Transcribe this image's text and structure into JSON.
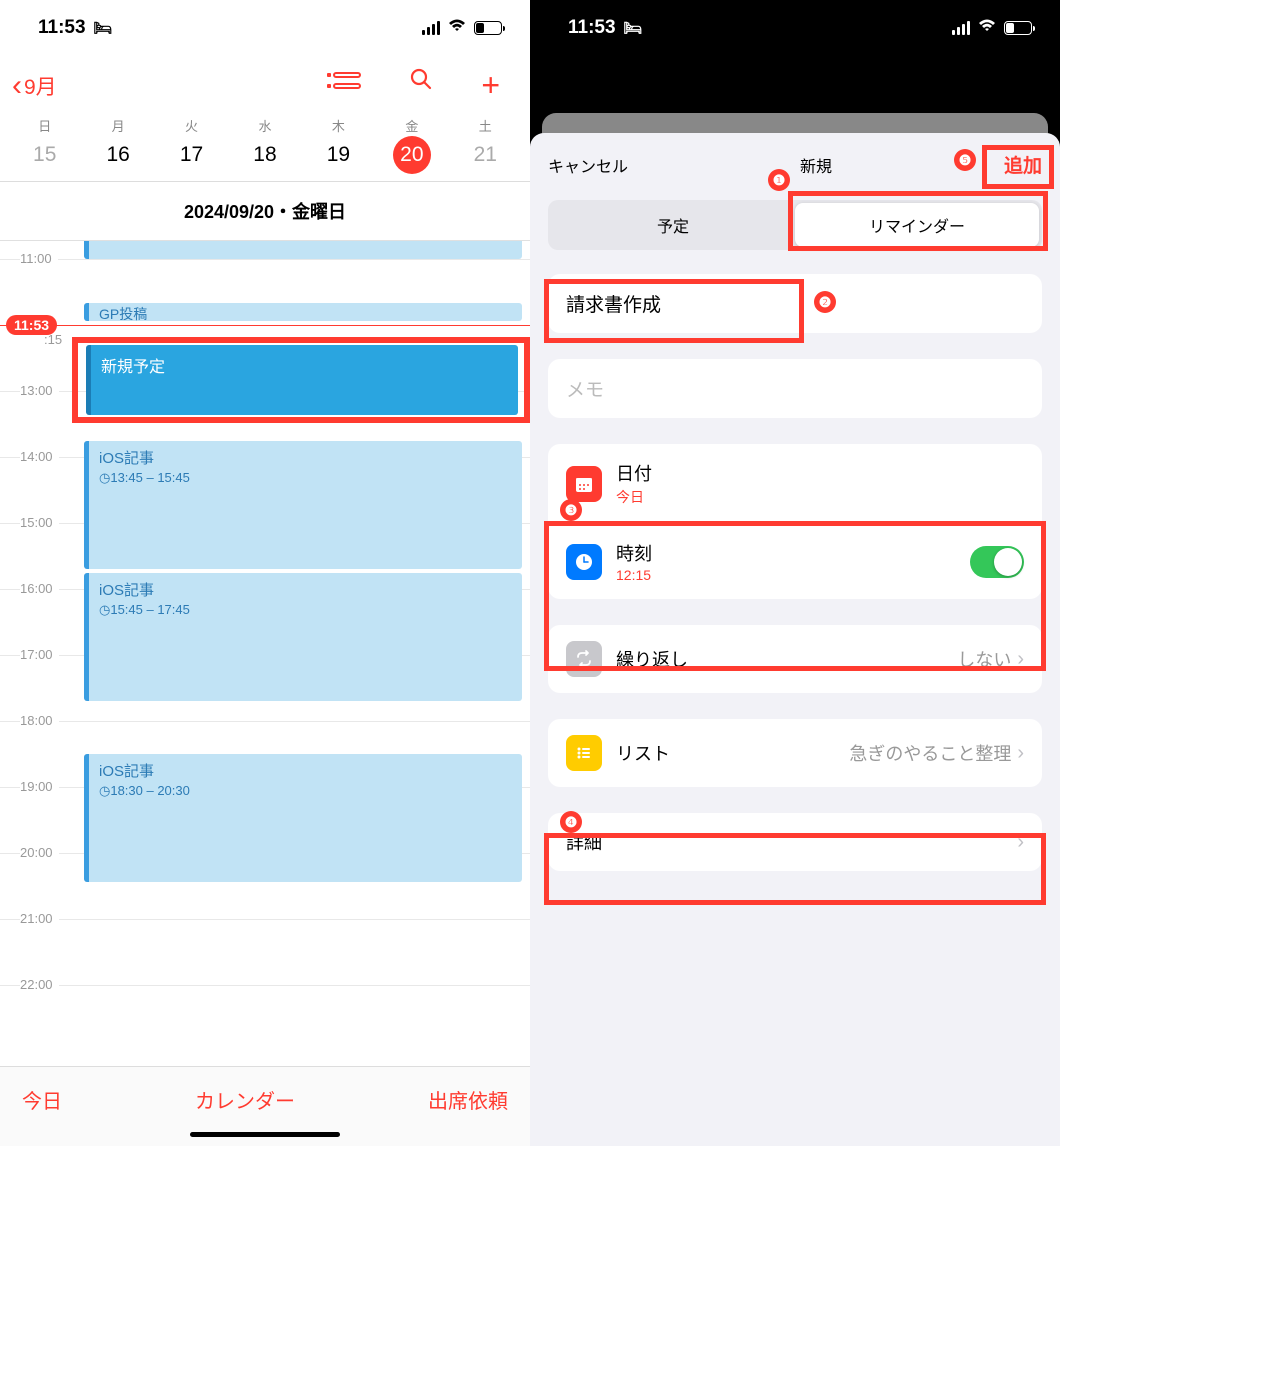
{
  "status": {
    "time": "11:53",
    "bed_icon": "bed-icon"
  },
  "left": {
    "back_label": "9月",
    "week_days": [
      "日",
      "月",
      "火",
      "水",
      "木",
      "金",
      "土"
    ],
    "dates": [
      "15",
      "16",
      "17",
      "18",
      "19",
      "20",
      "21"
    ],
    "today_index": 5,
    "date_banner": "2024/09/20・金曜日",
    "hours": [
      "11:00",
      ":15",
      "13:00",
      "14:00",
      "15:00",
      "16:00",
      "17:00",
      "18:00",
      "19:00",
      "20:00",
      "21:00",
      "22:00"
    ],
    "current_time": "11:53",
    "events": {
      "gp": "GP投稿",
      "new_event": "新規予定",
      "ios1": {
        "title": "iOS記事",
        "time": "13:45 – 15:45"
      },
      "ios2": {
        "title": "iOS記事",
        "time": "15:45 – 17:45"
      },
      "ios3": {
        "title": "iOS記事",
        "time": "18:30 – 20:30"
      }
    },
    "bottom": {
      "today": "今日",
      "calendars": "カレンダー",
      "inbox": "出席依頼"
    }
  },
  "right": {
    "cancel": "キャンセル",
    "title": "新規",
    "add": "追加",
    "segment": {
      "event": "予定",
      "reminder": "リマインダー"
    },
    "title_field": "請求書作成",
    "memo_placeholder": "メモ",
    "date": {
      "label": "日付",
      "value": "今日"
    },
    "time": {
      "label": "時刻",
      "value": "12:15"
    },
    "repeat": {
      "label": "繰り返し",
      "value": "しない"
    },
    "list": {
      "label": "リスト",
      "value": "急ぎのやること整理"
    },
    "details": "詳細",
    "annotations": {
      "n1": "❶",
      "n2": "❷",
      "n3": "❸",
      "n4": "❹",
      "n5": "❺"
    }
  }
}
